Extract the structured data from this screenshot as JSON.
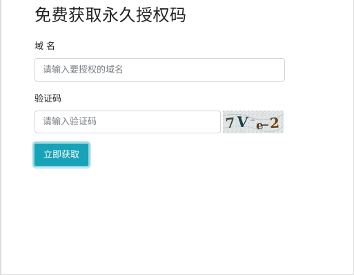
{
  "form": {
    "title": "免费获取永久授权码",
    "domain_label": "域名",
    "domain_placeholder": "请输入要授权的域名",
    "domain_value": "",
    "captcha_label": "验证码",
    "captcha_placeholder": "请输入验证码",
    "captcha_value": "",
    "captcha_image_text": "7Ve2",
    "submit_label": "立即获取"
  },
  "colors": {
    "button": "#17a2b8",
    "button_text": "#ffffff",
    "input_border": "#ced4da"
  }
}
